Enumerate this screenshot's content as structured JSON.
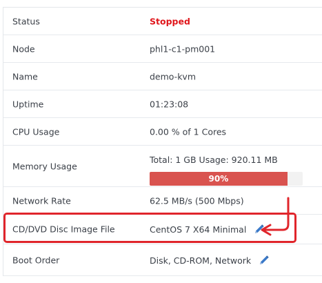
{
  "details": {
    "status": {
      "label": "Status",
      "value": "Stopped"
    },
    "node": {
      "label": "Node",
      "value": "phl1-c1-pm001"
    },
    "name": {
      "label": "Name",
      "value": "demo-kvm"
    },
    "uptime": {
      "label": "Uptime",
      "value": "01:23:08"
    },
    "cpu": {
      "label": "CPU Usage",
      "value": "0.00 % of 1 Cores"
    },
    "memory": {
      "label": "Memory Usage",
      "total_text": "Total: 1 GB Usage: 920.11 MB",
      "percent": 90,
      "percent_text": "90%"
    },
    "network": {
      "label": "Network Rate",
      "value": "62.5 MB/s (500 Mbps)"
    },
    "iso": {
      "label": "CD/DVD Disc Image File",
      "value": "CentOS 7 X64 Minimal"
    },
    "boot": {
      "label": "Boot Order",
      "value": "Disk, CD-ROM, Network"
    }
  },
  "colors": {
    "status_stopped": "#e0161b",
    "memory_bar": "#d9534f",
    "highlight": "#e0252b",
    "edit_icon": "#3a79c9"
  },
  "icons": {
    "edit": "pencil-icon"
  }
}
